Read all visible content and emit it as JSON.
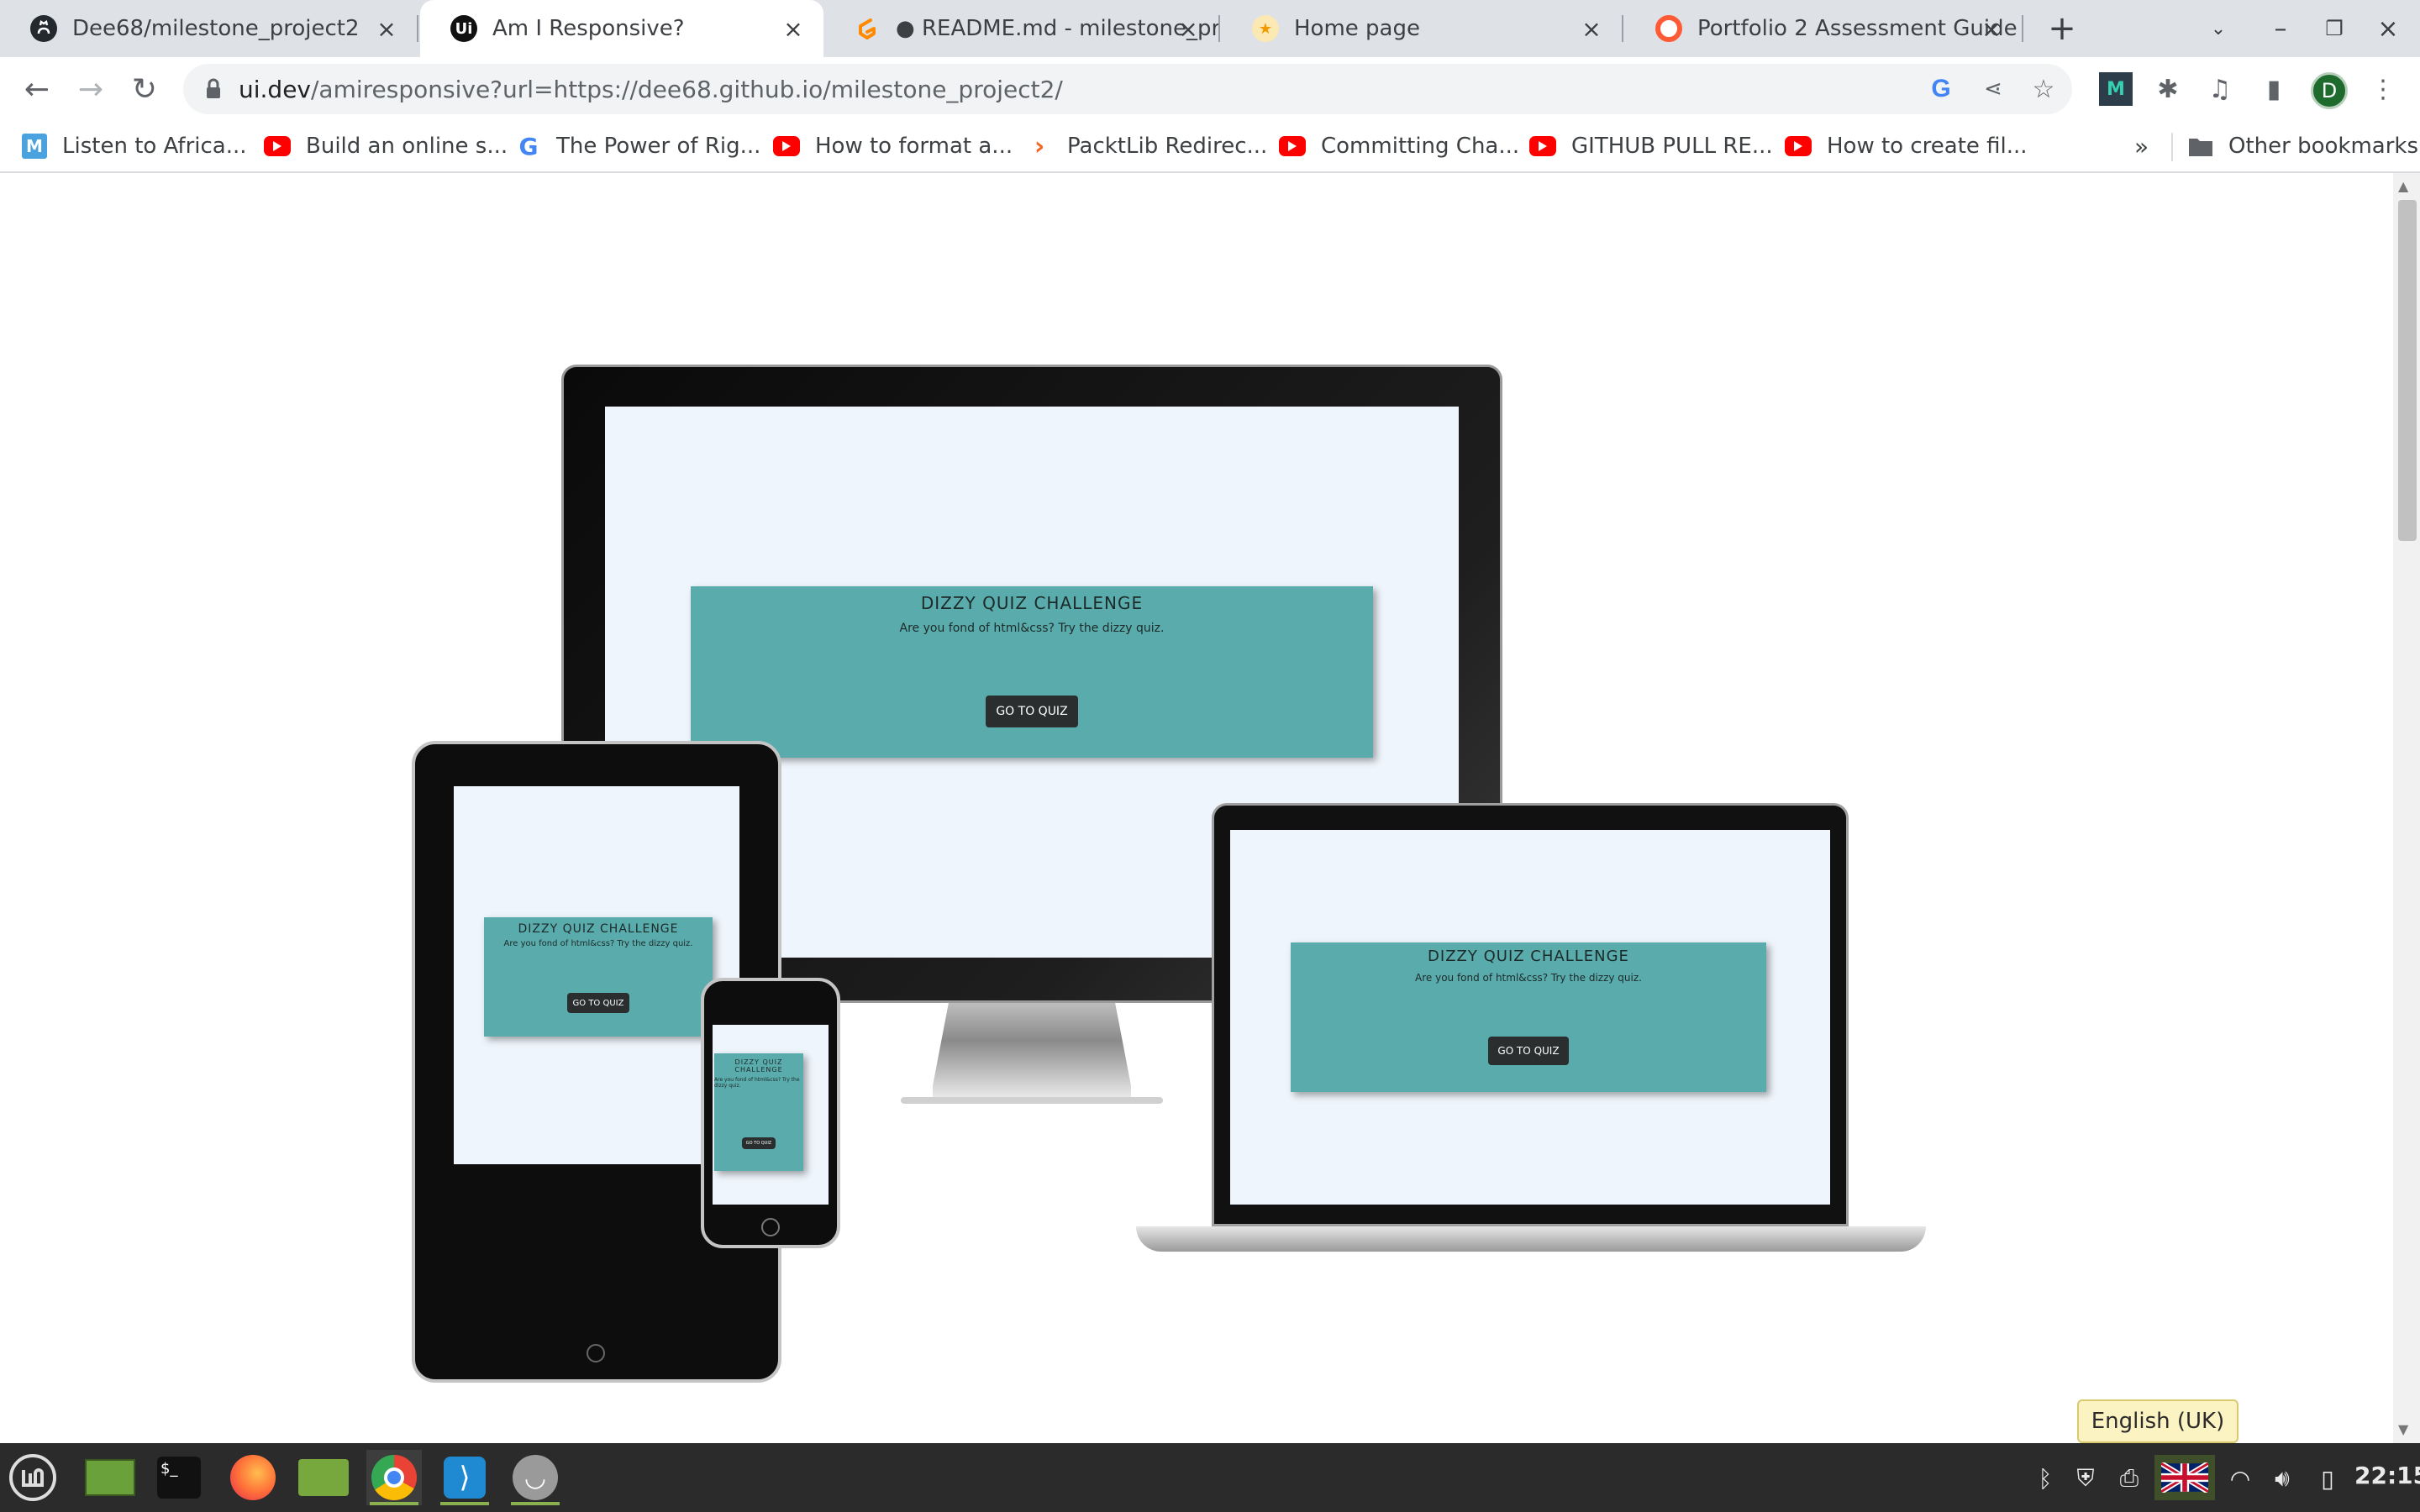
{
  "tabs": [
    {
      "title": "Dee68/milestone_project2",
      "active": false,
      "icon": "github-icon"
    },
    {
      "title": "Am I Responsive?",
      "active": true,
      "icon": "ui-dev-icon"
    },
    {
      "title": "● README.md - milestone_pr",
      "active": false,
      "icon": "gitpod-icon"
    },
    {
      "title": "Home page",
      "active": false,
      "icon": "star-icon"
    },
    {
      "title": "Portfolio 2 Assessment Guide",
      "active": false,
      "icon": "code-institute-icon"
    }
  ],
  "toolbar": {
    "url_host": "ui.dev",
    "url_path": "/amiresponsive?url=https://dee68.github.io/milestone_project2/",
    "profile_initial": "D"
  },
  "bookmarks": [
    {
      "label": "Listen to Africa...",
      "icon": "m-icon"
    },
    {
      "label": "Build an online s...",
      "icon": "youtube-icon"
    },
    {
      "label": "The Power of Rig...",
      "icon": "google-icon"
    },
    {
      "label": "How to format a...",
      "icon": "youtube-icon"
    },
    {
      "label": "PacktLib Redirec...",
      "icon": "packt-icon"
    },
    {
      "label": "Committing Cha...",
      "icon": "youtube-icon"
    },
    {
      "label": "GITHUB PULL RE...",
      "icon": "youtube-icon"
    },
    {
      "label": "How to create fil...",
      "icon": "youtube-icon"
    }
  ],
  "bookmarks_more": "»",
  "other_bookmarks": "Other bookmarks",
  "quiz": {
    "title": "DIZZY QUIZ CHALLENGE",
    "subtitle": "Are you fond of html&css? Try the dizzy quiz.",
    "button": "GO TO QUIZ"
  },
  "taskbar": {
    "clock": "22:15",
    "language_tooltip": "English (UK)",
    "apps": [
      "menu-icon",
      "show-desktop-icon",
      "terminal-icon",
      "firefox-icon",
      "files-icon",
      "chrome-icon",
      "vscode-icon",
      "network-manager-icon"
    ]
  },
  "colors": {
    "tab_strip": "#dee1e6",
    "quiz_box": "#5aabab",
    "screen_bg": "#eef5fc",
    "taskbar": "#2b2b2b"
  }
}
